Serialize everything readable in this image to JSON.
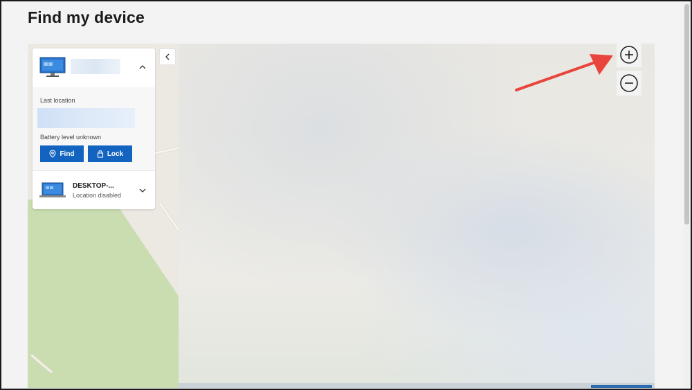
{
  "page": {
    "title": "Find my device"
  },
  "panel": {
    "selected_device": {
      "last_location_label": "Last location",
      "battery_label": "Battery level unknown",
      "find_label": "Find",
      "lock_label": "Lock"
    },
    "other_device": {
      "name": "DESKTOP-...",
      "status": "Location disabled"
    }
  },
  "map": {
    "zoom_in_icon": "plus-circle-icon",
    "zoom_out_icon": "minus-circle-icon"
  },
  "colors": {
    "accent": "#1264c0",
    "annotation": "#e8453c",
    "park": "#c9ddb0"
  }
}
